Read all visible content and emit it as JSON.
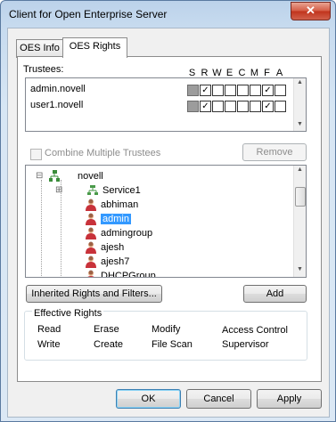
{
  "window": {
    "title": "Client for Open Enterprise Server",
    "close_glyph": "✕"
  },
  "tabs": [
    {
      "label": "OES Info"
    },
    {
      "label": "OES Rights"
    }
  ],
  "trustees": {
    "label": "Trustees:",
    "columns": [
      "S",
      "R",
      "W",
      "E",
      "C",
      "M",
      "F",
      "A"
    ],
    "rows": [
      {
        "name": "admin.novell",
        "rights": [
          null,
          true,
          false,
          false,
          false,
          false,
          true,
          false
        ]
      },
      {
        "name": "user1.novell",
        "rights": [
          null,
          true,
          false,
          false,
          false,
          false,
          true,
          false
        ]
      }
    ]
  },
  "combine": {
    "label": "Combine Multiple Trustees",
    "checked": false
  },
  "remove_button": "Remove",
  "tree": {
    "root": {
      "label": "novell",
      "expander": "⊟"
    },
    "items": [
      {
        "label": "Service1",
        "expander": "⊞"
      },
      {
        "label": "abhiman"
      },
      {
        "label": "admin",
        "selected": true
      },
      {
        "label": "admingroup"
      },
      {
        "label": "ajesh"
      },
      {
        "label": "ajesh7"
      },
      {
        "label": "DHCPGroup"
      }
    ]
  },
  "inherited_button": "Inherited Rights and Filters...",
  "add_button": "Add",
  "effective_rights": {
    "label": "Effective Rights",
    "items": [
      "Read",
      "Erase",
      "Modify",
      "Access Control",
      "Write",
      "Create",
      "File Scan",
      "Supervisor"
    ]
  },
  "footer": {
    "ok": "OK",
    "cancel": "Cancel",
    "apply": "Apply"
  },
  "colors": {
    "selection": "#3399ff",
    "close": "#c94a33"
  }
}
